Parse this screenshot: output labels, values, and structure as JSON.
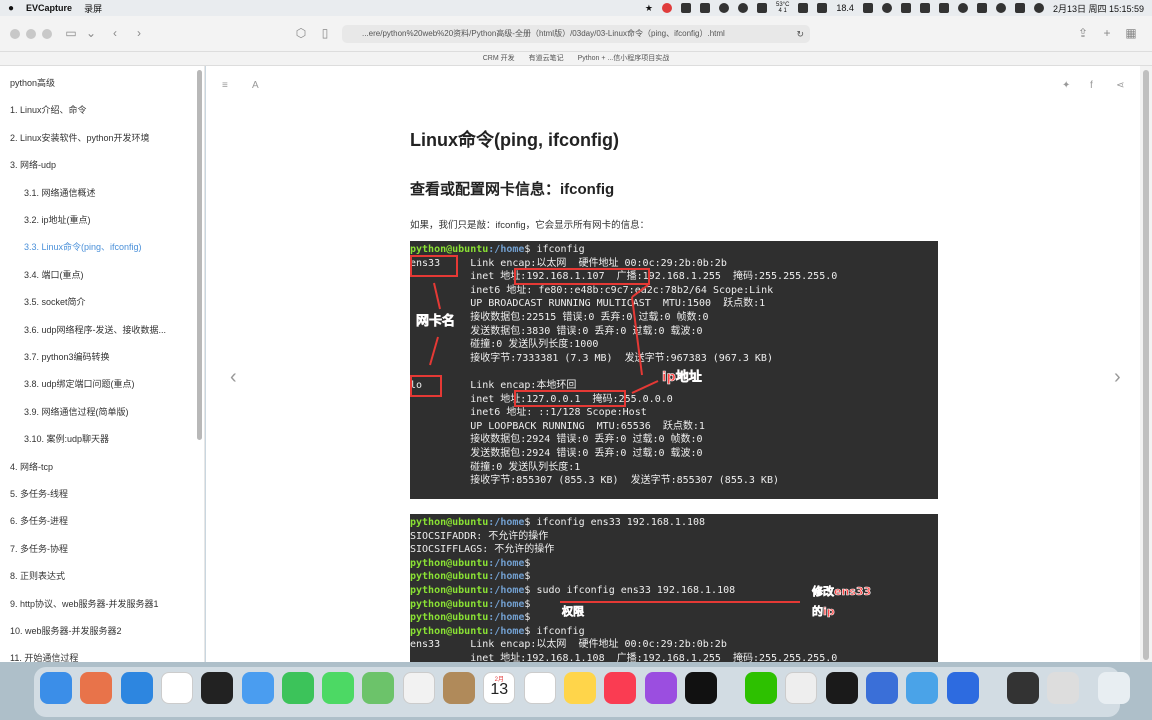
{
  "menubar": {
    "app_name": "EVCapture",
    "menu_item": "录屏",
    "stats_top": "53°C",
    "stats_bottom": "4 1",
    "battery_text": "18.4",
    "date_time": "2月13日 周四 15:15:59"
  },
  "browser": {
    "url": "...ere/python%20web%20资料/Python高级-全册（html版）/03day/03-Linux命令（ping、ifconfig）.html",
    "bookmarks": [
      "CRM 开发",
      "有道云笔记",
      "Python + ...信小程序项目实战"
    ]
  },
  "sidebar": {
    "items": [
      {
        "label": "python高级",
        "level": 0,
        "active": false
      },
      {
        "label": "1. Linux介绍、命令",
        "level": 0,
        "active": false
      },
      {
        "label": "2. Linux安装软件、python开发环境",
        "level": 0,
        "active": false
      },
      {
        "label": "3. 网络-udp",
        "level": 0,
        "active": false
      },
      {
        "label": "3.1. 网络通信概述",
        "level": 1,
        "active": false
      },
      {
        "label": "3.2. ip地址(重点)",
        "level": 1,
        "active": false
      },
      {
        "label": "3.3. Linux命令(ping、ifconfig)",
        "level": 1,
        "active": true
      },
      {
        "label": "3.4. 端口(重点)",
        "level": 1,
        "active": false
      },
      {
        "label": "3.5. socket简介",
        "level": 1,
        "active": false
      },
      {
        "label": "3.6. udp网络程序-发送、接收数据...",
        "level": 1,
        "active": false
      },
      {
        "label": "3.7. python3编码转换",
        "level": 1,
        "active": false
      },
      {
        "label": "3.8. udp绑定端口问题(重点)",
        "level": 1,
        "active": false
      },
      {
        "label": "3.9. 网络通信过程(简单版)",
        "level": 1,
        "active": false
      },
      {
        "label": "3.10. 案例:udp聊天器",
        "level": 1,
        "active": false
      },
      {
        "label": "4. 网络-tcp",
        "level": 0,
        "active": false
      },
      {
        "label": "5. 多任务-线程",
        "level": 0,
        "active": false
      },
      {
        "label": "6. 多任务-进程",
        "level": 0,
        "active": false
      },
      {
        "label": "7. 多任务-协程",
        "level": 0,
        "active": false
      },
      {
        "label": "8. 正则表达式",
        "level": 0,
        "active": false
      },
      {
        "label": "9. http协议、web服务器-并发服务器1",
        "level": 0,
        "active": false
      },
      {
        "label": "10. web服务器-并发服务器2",
        "level": 0,
        "active": false
      },
      {
        "label": "11. 开始通信过程",
        "level": 0,
        "active": false
      }
    ]
  },
  "content": {
    "title": "Linux命令(ping, ifconfig)",
    "section_title": "查看或配置网卡信息：ifconfig",
    "paragraph": "如果，我们只是敲：ifconfig，它会显示所有网卡的信息：",
    "terminal1": {
      "lines": [
        {
          "prompt": "python@ubuntu",
          "path": ":/home",
          "cmd": "$ ifconfig"
        },
        {
          "text": "ens33     Link encap:以太网  硬件地址 00:0c:29:2b:0b:2b"
        },
        {
          "text": "          inet 地址:192.168.1.107  广播:192.168.1.255  掩码:255.255.255.0"
        },
        {
          "text": "          inet6 地址: fe80::e48b:c9c7:ea2c:78b2/64 Scope:Link"
        },
        {
          "text": "          UP BROADCAST RUNNING MULTICAST  MTU:1500  跃点数:1"
        },
        {
          "text": "          接收数据包:22515 错误:0 丢弃:0 过载:0 帧数:0"
        },
        {
          "text": "          发送数据包:3830 错误:0 丢弃:0 过载:0 载波:0"
        },
        {
          "text": "          碰撞:0 发送队列长度:1000"
        },
        {
          "text": "          接收字节:7333381 (7.3 MB)  发送字节:967383 (967.3 KB)"
        },
        {
          "text": ""
        },
        {
          "text": "lo        Link encap:本地环回"
        },
        {
          "text": "          inet 地址:127.0.0.1  掩码:255.0.0.0"
        },
        {
          "text": "          inet6 地址: ::1/128 Scope:Host"
        },
        {
          "text": "          UP LOOPBACK RUNNING  MTU:65536  跃点数:1"
        },
        {
          "text": "          接收数据包:2924 错误:0 丢弃:0 过载:0 帧数:0"
        },
        {
          "text": "          发送数据包:2924 错误:0 丢弃:0 过载:0 载波:0"
        },
        {
          "text": "          碰撞:0 发送队列长度:1"
        },
        {
          "text": "          接收字节:855307 (855.3 KB)  发送字节:855307 (855.3 KB)"
        }
      ],
      "annotation_nic": "网卡名",
      "annotation_ip": "ip地址"
    },
    "terminal2": {
      "lines": [
        {
          "prompt": "python@ubuntu",
          "path": ":/home",
          "cmd": "$ ifconfig ens33 192.168.1.108"
        },
        {
          "text": "SIOCSIFADDR: 不允许的操作"
        },
        {
          "text": "SIOCSIFFLAGS: 不允许的操作"
        },
        {
          "prompt": "python@ubuntu",
          "path": ":/home",
          "cmd": "$"
        },
        {
          "prompt": "python@ubuntu",
          "path": ":/home",
          "cmd": "$"
        },
        {
          "prompt": "python@ubuntu",
          "path": ":/home",
          "cmd": "$ sudo ifconfig ens33 192.168.1.108"
        },
        {
          "prompt": "python@ubuntu",
          "path": ":/home",
          "cmd": "$"
        },
        {
          "prompt": "python@ubuntu",
          "path": ":/home",
          "cmd": "$"
        },
        {
          "prompt": "python@ubuntu",
          "path": ":/home",
          "cmd": "$ ifconfig"
        },
        {
          "text": "ens33     Link encap:以太网  硬件地址 00:0c:29:2b:0b:2b"
        },
        {
          "text": "          inet 地址:192.168.1.108  广播:192.168.1.255  掩码:255.255.255.0"
        }
      ],
      "annotation_modify_line1": "修改ens33",
      "annotation_modify_line2": "的ip",
      "annotation_permission": "权限"
    }
  },
  "dock": {
    "calendar_month": "2月",
    "calendar_day": "13",
    "apps": [
      "finder",
      "launchpad",
      "safari",
      "chrome",
      "terminal",
      "mail",
      "facetime",
      "messages",
      "maps",
      "photos",
      "contacts",
      "calendar",
      "reminders",
      "notes",
      "music",
      "podcasts",
      "tv",
      "wechat",
      "qq",
      "pycharm",
      "screens",
      "evcapture",
      "zoom",
      "window1",
      "window2",
      "trash"
    ]
  },
  "colors": {
    "accent": "#4a90d9",
    "terminal_bg": "#2f2f2f",
    "prompt_green": "#8ae234",
    "path_blue": "#729fcf",
    "annotation_red": "#e53935"
  }
}
